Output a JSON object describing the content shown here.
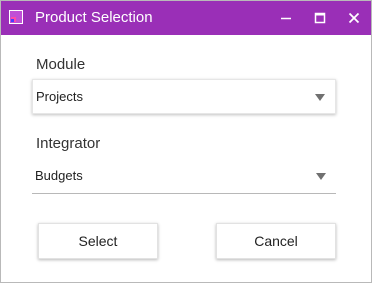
{
  "window": {
    "title": "Product Selection",
    "accent_color": "#9a2fb7",
    "icons": {
      "app": "product-app-icon",
      "minimize": "minimize-icon",
      "maximize": "maximize-icon",
      "close": "close-icon"
    }
  },
  "form": {
    "module": {
      "label": "Module",
      "selected_value": "Projects"
    },
    "integrator": {
      "label": "Integrator",
      "selected_value": "Budgets"
    }
  },
  "actions": {
    "select_label": "Select",
    "cancel_label": "Cancel"
  }
}
